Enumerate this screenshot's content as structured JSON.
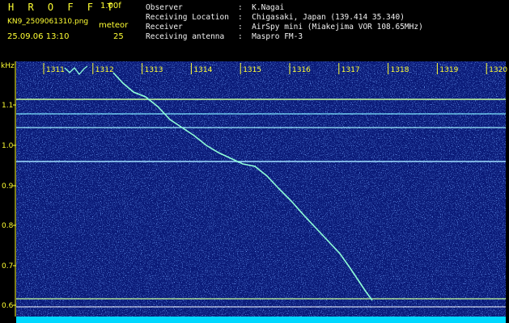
{
  "header": {
    "brand": "H R O F F T",
    "version": "1.00f",
    "filename": "KN9_2509061310.png",
    "meteor_label": "meteor",
    "datetime": "25.09.06 13:10",
    "meteor_count": "25"
  },
  "info": [
    {
      "key": "Observer",
      "value": "K.Nagai"
    },
    {
      "key": "Receiving Location",
      "value": "Chigasaki, Japan (139.414 35.340)"
    },
    {
      "key": "Receiver",
      "value": "AirSpy mini (Miakejima VOR 108.65MHz)"
    },
    {
      "key": "Receiving antenna",
      "value": "Maspro FM-3"
    }
  ],
  "spectrogram": {
    "y_unit": "kHz",
    "y_ticks": [
      "1.1",
      "1.0",
      "0.9",
      "0.8",
      "0.7",
      "0.6"
    ],
    "time_ticks": [
      "1311",
      "1312",
      "1313",
      "1314",
      "1315",
      "1316",
      "1317",
      "1318",
      "1319",
      "1320"
    ],
    "colors": {
      "background": "#0a1a78",
      "accent": "#ffff33",
      "trace": "#7fffd4",
      "bottom_bar": "#00d8ff"
    }
  }
}
